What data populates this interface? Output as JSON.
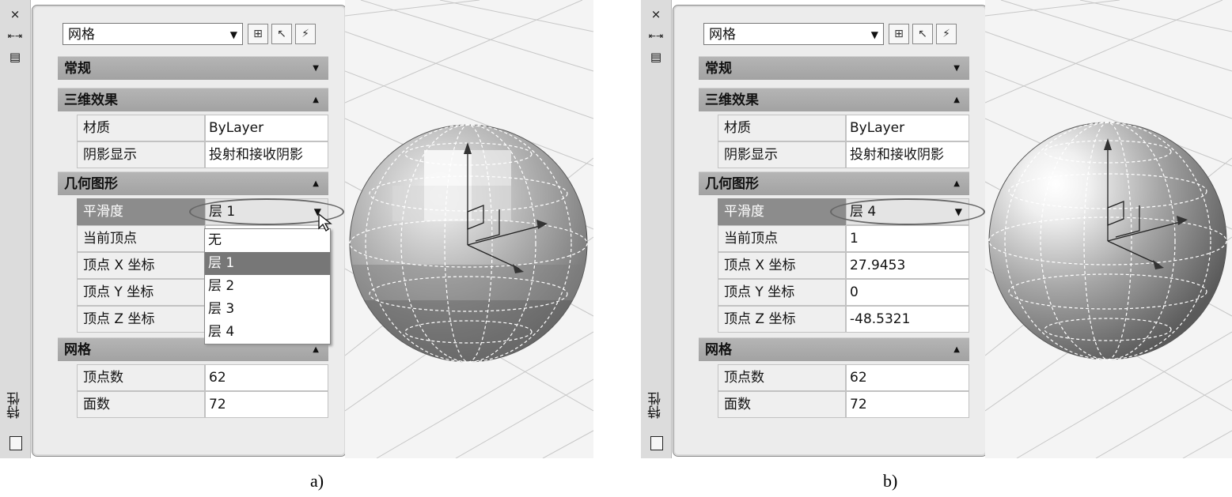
{
  "panels": [
    {
      "sidebar": {
        "close_glyph": "×",
        "autohide_glyph": "⇤⇥",
        "props_glyph": "▤",
        "title": "特性",
        "bottom_icon": "properties-icon"
      },
      "selector": {
        "value": "网格"
      },
      "categories": {
        "general": "常规",
        "effects3d": "三维效果",
        "geometry": "几何图形",
        "mesh": "网格"
      },
      "effects_rows": [
        {
          "key": "材质",
          "value": "ByLayer"
        },
        {
          "key": "阴影显示",
          "value": "投射和接收阴影"
        }
      ],
      "geometry_rows": [
        {
          "key": "平滑度",
          "value": "层 1"
        },
        {
          "key": "当前顶点",
          "value": ""
        },
        {
          "key": "顶点 X 坐标",
          "value": ""
        },
        {
          "key": "顶点 Y 坐标",
          "value": ""
        },
        {
          "key": "顶点 Z 坐标",
          "value": ""
        }
      ],
      "smoothness_dropdown": {
        "options": [
          "无",
          "层 1",
          "层 2",
          "层 3",
          "层 4"
        ],
        "selected_index": 1
      },
      "mesh_rows": [
        {
          "key": "顶点数",
          "value": "62"
        },
        {
          "key": "面数",
          "value": "72"
        }
      ],
      "caption": "a)"
    },
    {
      "sidebar": {
        "close_glyph": "×",
        "autohide_glyph": "⇤⇥",
        "props_glyph": "▤",
        "title": "特性",
        "bottom_icon": "properties-icon"
      },
      "selector": {
        "value": "网格"
      },
      "categories": {
        "general": "常规",
        "effects3d": "三维效果",
        "geometry": "几何图形",
        "mesh": "网格"
      },
      "effects_rows": [
        {
          "key": "材质",
          "value": "ByLayer"
        },
        {
          "key": "阴影显示",
          "value": "投射和接收阴影"
        }
      ],
      "geometry_rows": [
        {
          "key": "平滑度",
          "value": "层 4"
        },
        {
          "key": "当前顶点",
          "value": "1"
        },
        {
          "key": "顶点 X 坐标",
          "value": "27.9453"
        },
        {
          "key": "顶点 Y 坐标",
          "value": "0"
        },
        {
          "key": "顶点 Z 坐标",
          "value": "-48.5321"
        }
      ],
      "mesh_rows": [
        {
          "key": "顶点数",
          "value": "62"
        },
        {
          "key": "面数",
          "value": "72"
        }
      ],
      "caption": "b)"
    }
  ]
}
